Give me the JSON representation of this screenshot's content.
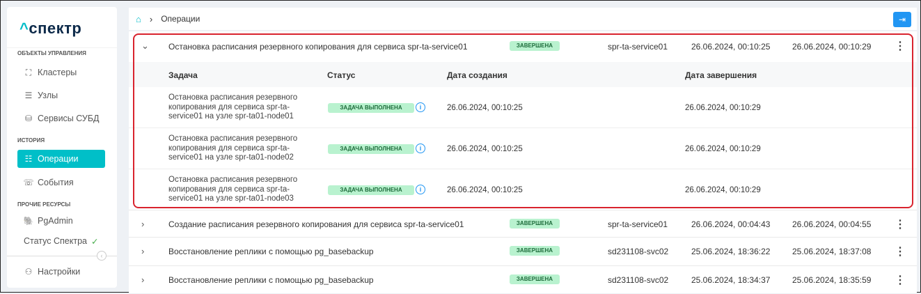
{
  "sidebar": {
    "logo": "спектр",
    "sections": [
      {
        "title": "ОБЪЕКТЫ УПРАВЛЕНИЯ"
      },
      {
        "title": "ИСТОРИЯ"
      },
      {
        "title": "ПРОЧИЕ РЕСУРСЫ"
      }
    ],
    "items": [
      {
        "label": "Кластеры"
      },
      {
        "label": "Узлы"
      },
      {
        "label": "Сервисы СУБД"
      },
      {
        "label": "Операции"
      },
      {
        "label": "События"
      },
      {
        "label": "PgAdmin"
      },
      {
        "label": "Статус Спектра"
      },
      {
        "label": "Настройки"
      }
    ]
  },
  "breadcrumb": {
    "current": "Операции"
  },
  "operations": [
    {
      "name": "Остановка расписания резервного копирования для сервиса spr-ta-service01",
      "status": "ЗАВЕРШЕНА",
      "service": "spr-ta-service01",
      "created": "26.06.2024, 00:10:25",
      "finished": "26.06.2024, 00:10:29"
    },
    {
      "name": "Создание расписания резервного копирования для сервиса spr-ta-service01",
      "status": "ЗАВЕРШЕНА",
      "service": "spr-ta-service01",
      "created": "26.06.2024, 00:04:43",
      "finished": "26.06.2024, 00:04:55"
    },
    {
      "name": "Восстановление реплики с помощью pg_basebackup",
      "status": "ЗАВЕРШЕНА",
      "service": "sd231108-svc02",
      "created": "25.06.2024, 18:36:22",
      "finished": "25.06.2024, 18:37:08"
    },
    {
      "name": "Восстановление реплики с помощью pg_basebackup",
      "status": "ЗАВЕРШЕНА",
      "service": "sd231108-svc02",
      "created": "25.06.2024, 18:34:37",
      "finished": "25.06.2024, 18:35:59"
    }
  ],
  "subtable": {
    "headers": {
      "task": "Задача",
      "status": "Статус",
      "created": "Дата создания",
      "finished": "Дата завершения"
    },
    "rows": [
      {
        "task": "Остановка расписания резервного копирования для сервиса spr-ta-service01 на узле spr-ta01-node01",
        "status": "ЗАДАЧА ВЫПОЛНЕНА",
        "created": "26.06.2024, 00:10:25",
        "finished": "26.06.2024, 00:10:29"
      },
      {
        "task": "Остановка расписания резервного копирования для сервиса spr-ta-service01 на узле spr-ta01-node02",
        "status": "ЗАДАЧА ВЫПОЛНЕНА",
        "created": "26.06.2024, 00:10:25",
        "finished": "26.06.2024, 00:10:29"
      },
      {
        "task": "Остановка расписания резервного копирования для сервиса spr-ta-service01 на узле spr-ta01-node03",
        "status": "ЗАДАЧА ВЫПОЛНЕНА",
        "created": "26.06.2024, 00:10:25",
        "finished": "26.06.2024, 00:10:29"
      }
    ]
  }
}
